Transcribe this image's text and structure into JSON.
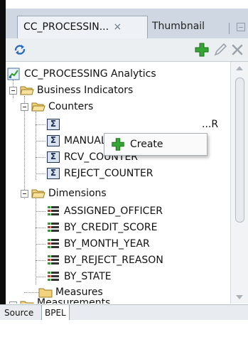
{
  "tabs": {
    "active": {
      "label": "CC_PROCESSIN...",
      "close": "×"
    },
    "inactive": {
      "label": "Thumbnail"
    }
  },
  "toolbar": {
    "icons": [
      "refresh-icon",
      "add-icon",
      "edit-icon",
      "delete-icon"
    ]
  },
  "tree": {
    "root": {
      "label": "CC_PROCESSING Analytics"
    },
    "business_indicators": {
      "label": "Business Indicators"
    },
    "counters": {
      "label": "Counters",
      "items": [
        {
          "label": "...R"
        },
        {
          "label": "MANUAL_COUNTER"
        },
        {
          "label": "RCV_COUNTER"
        },
        {
          "label": "REJECT_COUNTER"
        }
      ]
    },
    "dimensions": {
      "label": "Dimensions",
      "items": [
        {
          "label": "ASSIGNED_OFFICER"
        },
        {
          "label": "BY_CREDIT_SCORE"
        },
        {
          "label": "BY_MONTH_YEAR"
        },
        {
          "label": "BY_REJECT_REASON"
        },
        {
          "label": "BY_STATE"
        }
      ]
    },
    "measures": {
      "label": "Measures"
    },
    "cut_off": {
      "label": "Measurements"
    }
  },
  "context_menu": {
    "create": {
      "label": "Create"
    }
  },
  "bottom_tabs": [
    {
      "label": "Source"
    },
    {
      "label": "BPEL"
    }
  ],
  "colors": {
    "tab_bar": "#cfd8e2",
    "accent_green": "#2f9e2f",
    "folder_yellow": "#f2c94c"
  }
}
